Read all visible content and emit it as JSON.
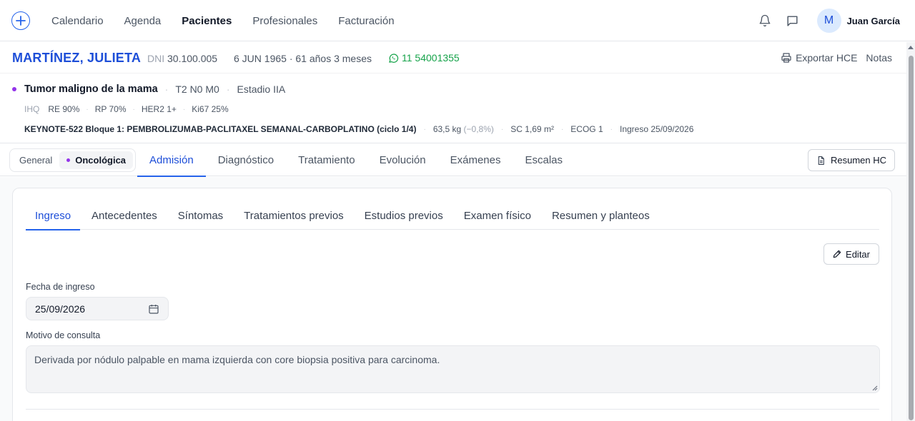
{
  "topnav": {
    "add_label": "+",
    "items": [
      "Calendario",
      "Agenda",
      "Pacientes",
      "Profesionales",
      "Facturación"
    ],
    "active_item": "Pacientes",
    "user": {
      "initial": "M",
      "name": "Juan García"
    }
  },
  "patient": {
    "name": "MARTÍNEZ, JULIETA",
    "dni_label": "DNI",
    "dni": "30.100.005",
    "birth": "6 JUN 1965 · 61 años 3 meses",
    "phone": "11 54001355",
    "export_label": "Exportar HCE",
    "notes_label": "Notas"
  },
  "diagnosis": {
    "title": "Tumor maligno de la mama",
    "tnm": "T2 N0 M0",
    "stage": "Estadio IIA",
    "ihq_label": "IHQ",
    "ihq": [
      "RE 90%",
      "RP 70%",
      "HER2 1+",
      "Ki67 25%"
    ],
    "scheme": "KEYNOTE-522 Bloque 1: PEMBROLIZUMAB-PACLITAXEL SEMANAL-CARBOPLATINO (ciclo 1/4)",
    "weight": "63,5 kg",
    "weight_change": "(−0,8%)",
    "sc": "SC 1,69 m²",
    "ecog": "ECOG 1",
    "admission": "Ingreso 25/09/2026"
  },
  "sections": {
    "segment": [
      "General",
      "Oncológica"
    ],
    "segment_active": "Oncológica",
    "tabs": [
      "Admisión",
      "Diagnóstico",
      "Tratamiento",
      "Evolución",
      "Exámenes",
      "Escalas"
    ],
    "active_tab": "Admisión",
    "summary_button": "Resumen HC"
  },
  "admission": {
    "subtabs": [
      "Ingreso",
      "Antecedentes",
      "Síntomas",
      "Tratamientos previos",
      "Estudios previos",
      "Examen físico",
      "Resumen y planteos"
    ],
    "active_subtab": "Ingreso",
    "edit_label": "Editar",
    "date_label": "Fecha de ingreso",
    "date_value": "25/09/2026",
    "reason_label": "Motivo de consulta",
    "reason_value": "Derivada por nódulo palpable en mama izquierda con core biopsia positiva para carcinoma."
  },
  "colors": {
    "accent": "#2563eb",
    "patient_name": "#1d4ed8",
    "phone": "#16a34a",
    "oncology_dot": "#9333ea"
  }
}
